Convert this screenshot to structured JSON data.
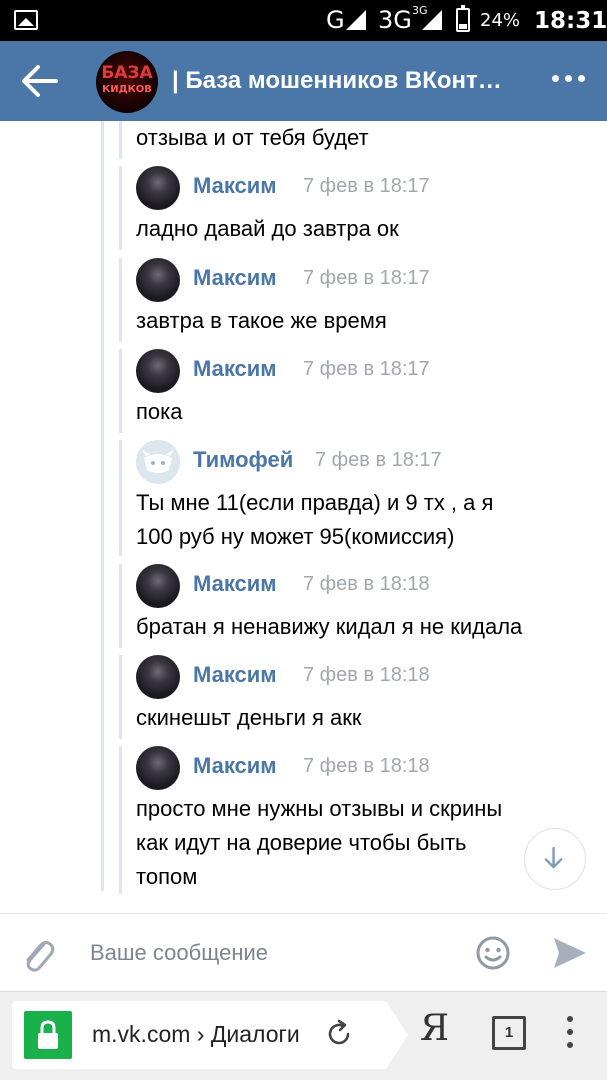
{
  "status_bar": {
    "network": "G",
    "network2": "3G",
    "network2_sup": "3G",
    "battery": "24%",
    "time": "18:31"
  },
  "header": {
    "title": "| База мошенников ВКонт…",
    "avatar_text_1": "БАЗА",
    "avatar_text_2": "КИДКОВ"
  },
  "messages": {
    "partial_text": "отзыва и от тебя будет",
    "items": [
      {
        "author": "Максим",
        "time": "7 фев в 18:17",
        "lines": [
          "ладно давай до завтра ок"
        ]
      },
      {
        "author": "Максим",
        "time": "7 фев в 18:17",
        "lines": [
          "завтра в такое же время"
        ]
      },
      {
        "author": "Максим",
        "time": "7 фев в 18:17",
        "lines": [
          "пока"
        ]
      },
      {
        "author": "Тимофей",
        "time": "7 фев в 18:17",
        "lines": [
          "Ты мне 11(если правда) и 9 тх , а я",
          "100 руб ну может 95(комиссия)"
        ]
      },
      {
        "author": "Максим",
        "time": "7 фев в 18:18",
        "lines": [
          "братан я ненавижу кидал я не кидала"
        ]
      },
      {
        "author": "Максим",
        "time": "7 фев в 18:18",
        "lines": [
          "скинешьт деньги я акк"
        ]
      },
      {
        "author": "Максим",
        "time": "7 фев в 18:18",
        "lines": [
          "просто мне нужны отзывы и скрины",
          "как идут на доверие чтобы быть",
          "топом"
        ]
      }
    ]
  },
  "composer": {
    "placeholder": "Ваше сообщение"
  },
  "browser": {
    "url": "m.vk.com › Диалоги",
    "tab_count": "1",
    "ya": "Я"
  },
  "colors": {
    "header_bg": "#4a76a8",
    "author": "#4a76a8",
    "lock_green": "#1ab04b"
  }
}
